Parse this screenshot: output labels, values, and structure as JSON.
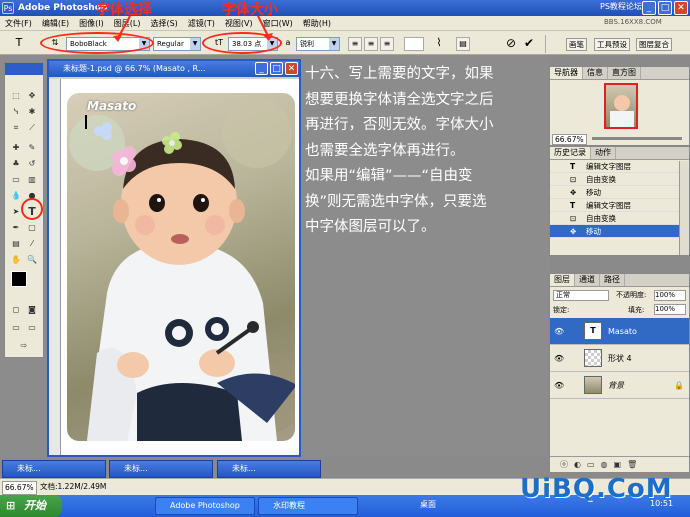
{
  "window": {
    "title": "Adobe Photoshop",
    "watermark_top": "PS教程论坛",
    "watermark_url": "BBS.16XX8.COM"
  },
  "menu": [
    "文件(F)",
    "编辑(E)",
    "图像(I)",
    "图层(L)",
    "选择(S)",
    "滤镜(T)",
    "视图(V)",
    "窗口(W)",
    "帮助(H)"
  ],
  "options": {
    "font_family": "BoboBlack",
    "font_style": "Regular",
    "font_size": "38.03 点",
    "antialias": "锐利",
    "annotation_font": "字体选择",
    "annotation_size": "字体大小",
    "tabs": [
      "画笔",
      "工具预设",
      "图层复合"
    ]
  },
  "document": {
    "title": "未标题-1.psd @ 66.7% (Masato , R...",
    "text_layer_content": "Masato"
  },
  "tutorial_text": [
    "十六、写上需要的文字，如果",
    "想要更换字体请全选文字之后",
    "再进行，否则无效。字体大小",
    "也需要全选字体再进行。",
    "如果用“编辑”——“自由变",
    "换”则无需选中字体，只要选",
    "中字体图层可以了。"
  ],
  "navigator": {
    "tabs": [
      "导航器",
      "信息",
      "直方图"
    ],
    "zoom": "66.67%"
  },
  "history": {
    "tabs": [
      "历史记录",
      "动作"
    ],
    "items": [
      "编辑文字图层",
      "自由变换",
      "移动",
      "编辑文字图层",
      "自由变换",
      "移动"
    ]
  },
  "layers": {
    "tabs": [
      "图层",
      "通道",
      "路径"
    ],
    "blend_mode": "正常",
    "opacity_label": "不透明度:",
    "opacity": "100%",
    "lock_label": "锁定:",
    "fill_label": "填充:",
    "fill": "100%",
    "items": [
      "Masato",
      "形状 4",
      "背景"
    ]
  },
  "minimized": [
    "未标...",
    "未标...",
    "未标..."
  ],
  "status": {
    "zoom": "66.67%",
    "doc": "文档:1.22M/2.49M"
  },
  "taskbar": {
    "start": "开始",
    "buttons": [
      "Adobe Photoshop",
      "水印教程"
    ],
    "desktop": "桌面",
    "clock": "10:51"
  },
  "brand": "UiBQ.CoM"
}
